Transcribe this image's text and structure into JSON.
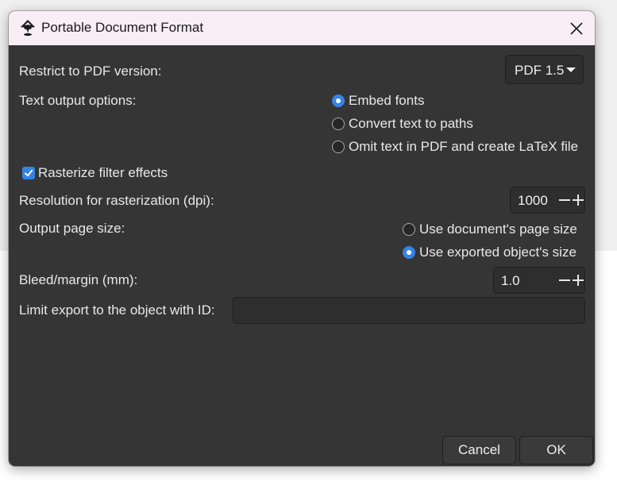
{
  "window": {
    "title": "Portable Document Format",
    "app_icon": "inkscape-icon",
    "close_icon": "close-icon"
  },
  "pdf_version": {
    "label": "Restrict to PDF version:",
    "selected": "PDF 1.5"
  },
  "text_output": {
    "label": "Text output options:",
    "options": [
      {
        "label": "Embed fonts",
        "checked": true
      },
      {
        "label": "Convert text to paths",
        "checked": false
      },
      {
        "label": "Omit text in PDF and create LaTeX file",
        "checked": false
      }
    ]
  },
  "rasterize": {
    "label": "Rasterize filter effects",
    "checked": true
  },
  "resolution": {
    "label": "Resolution for rasterization (dpi):",
    "value": "1000"
  },
  "page_size": {
    "label": "Output page size:",
    "options": [
      {
        "label": "Use document's page size",
        "checked": false
      },
      {
        "label": "Use exported object's size",
        "checked": true
      }
    ]
  },
  "bleed": {
    "label": "Bleed/margin (mm):",
    "value": "1.0"
  },
  "limit_export": {
    "label": "Limit export to the object with ID:",
    "value": ""
  },
  "buttons": {
    "cancel": "Cancel",
    "ok": "OK"
  },
  "colors": {
    "accent": "#3584e4",
    "dialog_bg": "#353535",
    "titlebar_bg": "#f9eef5"
  }
}
